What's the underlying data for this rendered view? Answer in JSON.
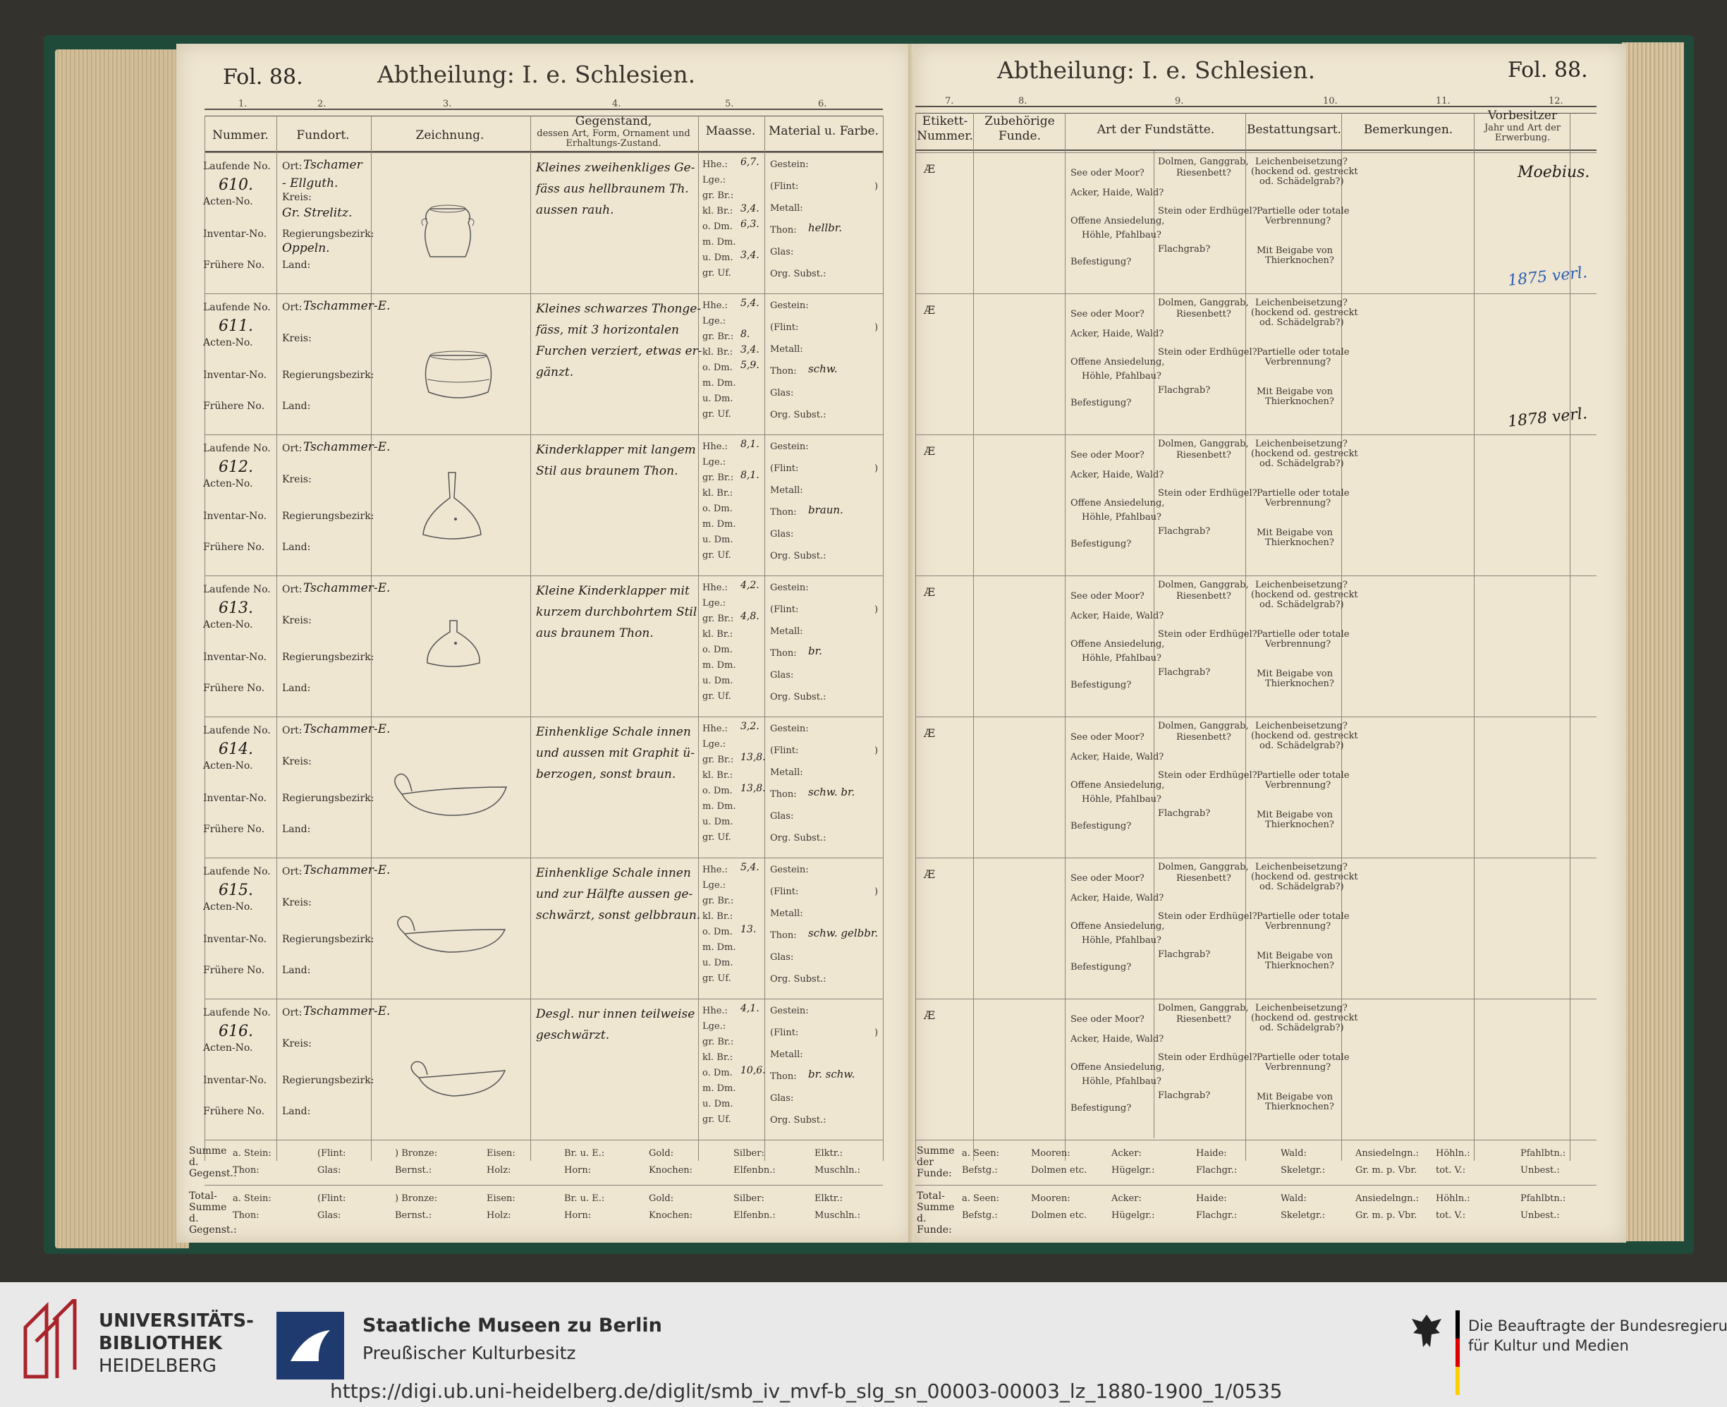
{
  "left_page": {
    "folio": "Fol. 88.",
    "division": "Abtheilung: I. e. Schlesien.",
    "column_numbers": [
      "1.",
      "2.",
      "3.",
      "4.",
      "5.",
      "6."
    ],
    "headers": {
      "nummer": "Nummer.",
      "fundort": "Fundort.",
      "zeichnung": "Zeichnung.",
      "gegenstand_1": "Gegenstand,",
      "gegenstand_2": "dessen Art, Form, Ornament und",
      "gegenstand_3": "Erhaltungs-Zustand.",
      "maasse": "Maasse.",
      "material": "Material u. Farbe."
    },
    "row_labels": {
      "laufende": "Laufende No.",
      "acten": "Acten-No.",
      "inventar": "Inventar-No.",
      "fruehere": "Frühere No.",
      "ort": "Ort:",
      "kreis": "Kreis:",
      "regbez": "Regierungsbezirk:",
      "land": "Land:",
      "hhe": "Hhe.:",
      "lge": "Lge.:",
      "grbr": "gr. Br.:",
      "klbr": "kl. Br.:",
      "odm": "o. Dm.",
      "mdm": "m. Dm.",
      "udm": "u. Dm.",
      "gruf": "gr. Uf.",
      "gestein": "Gestein:",
      "flint": "(Flint:",
      "flint_close": ")",
      "metall": "Metall:",
      "thon": "Thon:",
      "glas": "Glas:",
      "orgsubst": "Org. Subst.:"
    },
    "entries": [
      {
        "no": "610.",
        "ort": "Tschamer",
        "ort2": "- Ellguth.",
        "kreis": "Gr. Strelitz.",
        "regbez": "Oppeln.",
        "desc1": "Kleines zweihenkliges Ge-",
        "desc2": "fäss aus hellbraunem Th.",
        "desc3": "aussen rauh.",
        "hhe": "6,7.",
        "grbr": "",
        "klbr": "3,4.",
        "odm": "6,3.",
        "udm": "3,4.",
        "thon": "hellbr."
      },
      {
        "no": "611.",
        "ort": "Tschammer-E.",
        "ort2": "",
        "kreis": "",
        "regbez": "",
        "desc1": "Kleines schwarzes Thonge-",
        "desc2": "fäss, mit 3 horizontalen",
        "desc3": "Furchen verziert, etwas er-",
        "desc4": "gänzt.",
        "hhe": "5,4.",
        "grbr": "8.",
        "klbr": "3,4.",
        "odm": "5,9.",
        "udm": "",
        "thon": "schw."
      },
      {
        "no": "612.",
        "ort": "Tschammer-E.",
        "ort2": "",
        "kreis": "",
        "regbez": "",
        "desc1": "Kinderklapper mit langem",
        "desc2": "Stil aus braunem Thon.",
        "desc3": "",
        "hhe": "8,1.",
        "grbr": "8,1.",
        "klbr": "",
        "odm": "",
        "udm": "",
        "thon": "braun."
      },
      {
        "no": "613.",
        "ort": "Tschammer-E.",
        "ort2": "",
        "kreis": "",
        "regbez": "",
        "desc1": "Kleine Kinderklapper mit",
        "desc2": "kurzem durchbohrtem Stil",
        "desc3": "aus braunem Thon.",
        "hhe": "4,2.",
        "grbr": "4,8.",
        "klbr": "",
        "odm": "",
        "udm": "",
        "thon": "br."
      },
      {
        "no": "614.",
        "ort": "Tschammer-E.",
        "ort2": "",
        "kreis": "",
        "regbez": "",
        "desc1": "Einhenklige Schale innen",
        "desc2": "und aussen mit Graphit ü-",
        "desc3": "berzogen, sonst braun.",
        "hhe": "3,2.",
        "grbr": "13,8.",
        "klbr": "",
        "odm": "13,8.",
        "udm": "",
        "thon": "schw. br."
      },
      {
        "no": "615.",
        "ort": "Tschammer-E.",
        "ort2": "",
        "kreis": "",
        "regbez": "",
        "desc1": "Einhenklige Schale innen",
        "desc2": "und zur Hälfte aussen ge-",
        "desc3": "schwärzt, sonst gelbbraun.",
        "hhe": "5,4.",
        "grbr": "",
        "klbr": "",
        "odm": "13.",
        "udm": "",
        "thon": "schw. gelbbr."
      },
      {
        "no": "616.",
        "ort": "Tschammer-E.",
        "ort2": "",
        "kreis": "",
        "regbez": "",
        "desc1": "Desgl. nur innen teilweise",
        "desc2": "geschwärzt.",
        "desc3": "",
        "hhe": "4,1.",
        "grbr": "",
        "klbr": "",
        "odm": "10,6.",
        "udm": "",
        "thon": "br. schw."
      }
    ],
    "summe_label": "Summe d. Gegenst.:",
    "total_label": "Total-Summe d. Gegenst.:",
    "summe_row1": [
      "a. Stein:",
      "(Flint:",
      ") Bronze:",
      "Eisen:",
      "Br. u. E.:",
      "Gold:",
      "Silber:",
      "Elktr.:"
    ],
    "summe_row2": [
      "Thon:",
      "Glas:",
      "Bernst.:",
      "Holz:",
      "Horn:",
      "Knochen:",
      "Elfenbn.:",
      "Muschln.:"
    ]
  },
  "right_page": {
    "folio": "Fol. 88.",
    "division": "Abtheilung: I. e. Schlesien.",
    "column_numbers": [
      "7.",
      "8.",
      "9.",
      "10.",
      "11.",
      "12."
    ],
    "headers": {
      "etikett": "Etikett-Nummer.",
      "zubehoerige": "Zubehörige Funde.",
      "fundstaette": "Art der Fundstätte.",
      "bestattung": "Bestattungsart.",
      "bemerkungen": "Bemerkungen.",
      "vorbesitzer_1": "Vorbesitzer",
      "vorbesitzer_2": "Jahr und Art der",
      "vorbesitzer_3": "Erwerbung."
    },
    "etikett_mark": "Æ",
    "fund_labels": [
      "See oder Moor?",
      "Acker, Haide, Wald?",
      "Offene Ansiedelung,",
      "Höhle, Pfahlbau?",
      "Befestigung?"
    ],
    "grab_labels": [
      "Dolmen, Ganggrab,",
      "Riesenbett?",
      "Stein oder Erdhügel?",
      "Flachgrab?"
    ],
    "bestattung_labels": [
      "Leichenbeisetzung?",
      "(hockend od. gestreckt",
      "od. Schädelgrab?)",
      "Partielle oder totale",
      "Verbrennung?",
      "Mit Beigabe von",
      "Thierknochen?"
    ],
    "vorbesitzer_notes": [
      "Moebius.",
      "1875 verl.",
      "1878 verl."
    ],
    "summe_row1": [
      "a. Seen:",
      "Mooren:",
      "Acker:",
      "Haide:",
      "Wald:",
      "Ansiedelngn.:",
      "Höhln.:",
      "Pfahlbtn.:"
    ],
    "summe_row2": [
      "Befstg.:",
      "Dolmen etc.",
      "Hügelgr.:",
      "Flachgr.:",
      "Skeletgr.:",
      "Gr. m. p. Vbr.",
      "tot. V.:",
      "Unbest.:"
    ],
    "summe_label": "Summe der Funde:",
    "total_label": "Total-Summe d. Funde:"
  },
  "footer": {
    "uni_line1": "UNIVERSITÄTS-",
    "uni_line2": "BIBLIOTHEK",
    "uni_line3": "HEIDELBERG",
    "smb_line1": "Staatliche Museen zu Berlin",
    "smb_line2": "Preußischer Kulturbesitz",
    "bkm_line1": "Die Beauftragte der Bundesregierung",
    "bkm_line2": "für Kultur und Medien",
    "url": "https://digi.ub.uni-heidelberg.de/diglit/smb_iv_mvf-b_slg_sn_00003-00003_lz_1880-1900_1/0535",
    "colors": {
      "heidelberg_red": "#a8232a",
      "smb_blue": "#1e3a6e",
      "bg": "#e9e9e9"
    }
  }
}
